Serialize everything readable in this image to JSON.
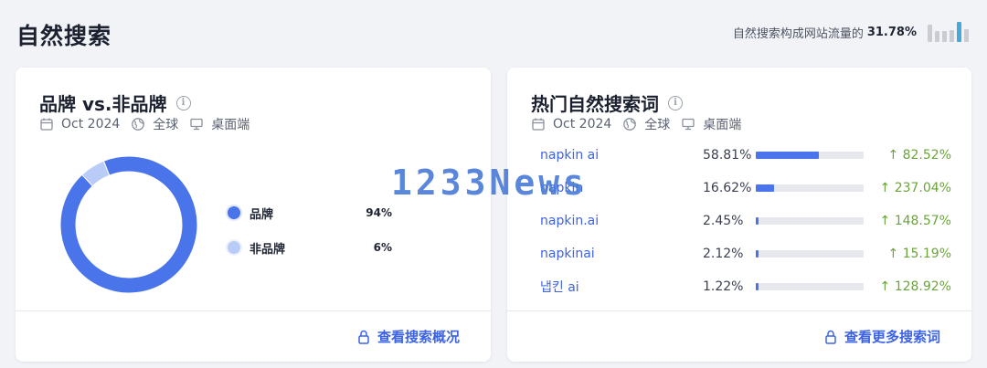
{
  "page": {
    "title": "自然搜索"
  },
  "traffic_summary": {
    "label": "自然搜索构成网站流量的",
    "percent": "31.78%",
    "bars": [
      0.85,
      0.55,
      0.55,
      0.6,
      1.0,
      0.65
    ]
  },
  "brand_card": {
    "title": "品牌 vs.非品牌",
    "meta": {
      "date": "Oct 2024",
      "region": "全球",
      "device": "桌面端"
    },
    "chart_data": {
      "type": "pie",
      "categories": [
        "品牌",
        "非品牌"
      ],
      "values": [
        94,
        6
      ]
    },
    "legend": [
      {
        "label": "品牌",
        "value": "94%",
        "color": "#4a74ea"
      },
      {
        "label": "非品牌",
        "value": "6%",
        "color": "#b9ccf7"
      }
    ],
    "footer_link": "查看搜索概况"
  },
  "keywords_card": {
    "title": "热门自然搜索词",
    "meta": {
      "date": "Oct 2024",
      "region": "全球",
      "device": "桌面端"
    },
    "rows": [
      {
        "keyword": "napkin ai",
        "share": "58.81%",
        "bar": 0.5881,
        "change": "↑ 82.52%"
      },
      {
        "keyword": "napkin",
        "share": "16.62%",
        "bar": 0.1662,
        "change": "↑ 237.04%"
      },
      {
        "keyword": "napkin.ai",
        "share": "2.45%",
        "bar": 0.0245,
        "change": "↑ 148.57%"
      },
      {
        "keyword": "napkinai",
        "share": "2.12%",
        "bar": 0.0212,
        "change": "↑ 15.19%"
      },
      {
        "keyword": "냅킨 ai",
        "share": "1.22%",
        "bar": 0.0122,
        "change": "↑ 128.92%"
      }
    ],
    "footer_link": "查看更多搜索词"
  },
  "watermark": {
    "text": "1233News"
  },
  "colors": {
    "accent": "#3d63e6",
    "positive": "#6ba33c",
    "brand": "#4a74ea",
    "nonbrand": "#b9ccf7"
  }
}
